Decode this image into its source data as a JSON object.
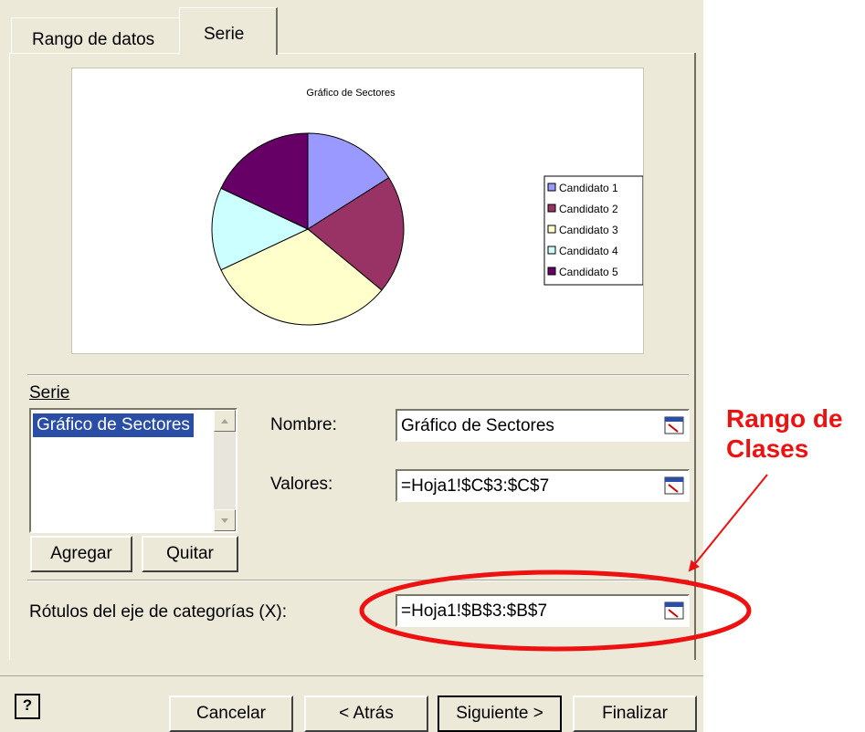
{
  "tabs": [
    {
      "label": "Rango de datos",
      "active": false
    },
    {
      "label": "Serie",
      "active": true
    }
  ],
  "preview": {
    "chart_data": {
      "type": "pie",
      "title": "Gráfico de Sectores",
      "categories": [
        "Candidato 1",
        "Candidato 2",
        "Candidato 3",
        "Candidato 4",
        "Candidato 5"
      ],
      "values": [
        16,
        20,
        32,
        14,
        18
      ],
      "colors": [
        "#9999ff",
        "#993366",
        "#ffffcc",
        "#ccffff",
        "#660066"
      ],
      "legend_labels": [
        "Candidato 1",
        "Candidato 2",
        "Candidato 3",
        "Candidato 4",
        "Candidato 5"
      ],
      "legend_position": "right"
    }
  },
  "series": {
    "section_label": "Serie",
    "items": [
      "Gráfico de Sectores"
    ],
    "add_label": "Agregar",
    "remove_label": "Quitar"
  },
  "fields": {
    "name_label": "Nombre:",
    "name_value": "Gráfico de Sectores",
    "values_label": "Valores:",
    "values_value": "=Hoja1!$C$3:$C$7",
    "category_label": "Rótulos del eje de categorías (X):",
    "category_value": "=Hoja1!$B$3:$B$7"
  },
  "footer": {
    "help_icon": "?",
    "cancel_label": "Cancelar",
    "back_label": "< Atrás",
    "next_label": "Siguiente >",
    "finish_label": "Finalizar"
  },
  "annotation": {
    "line1": "Rango de",
    "line2": "Clases",
    "color": "#ee1111"
  }
}
